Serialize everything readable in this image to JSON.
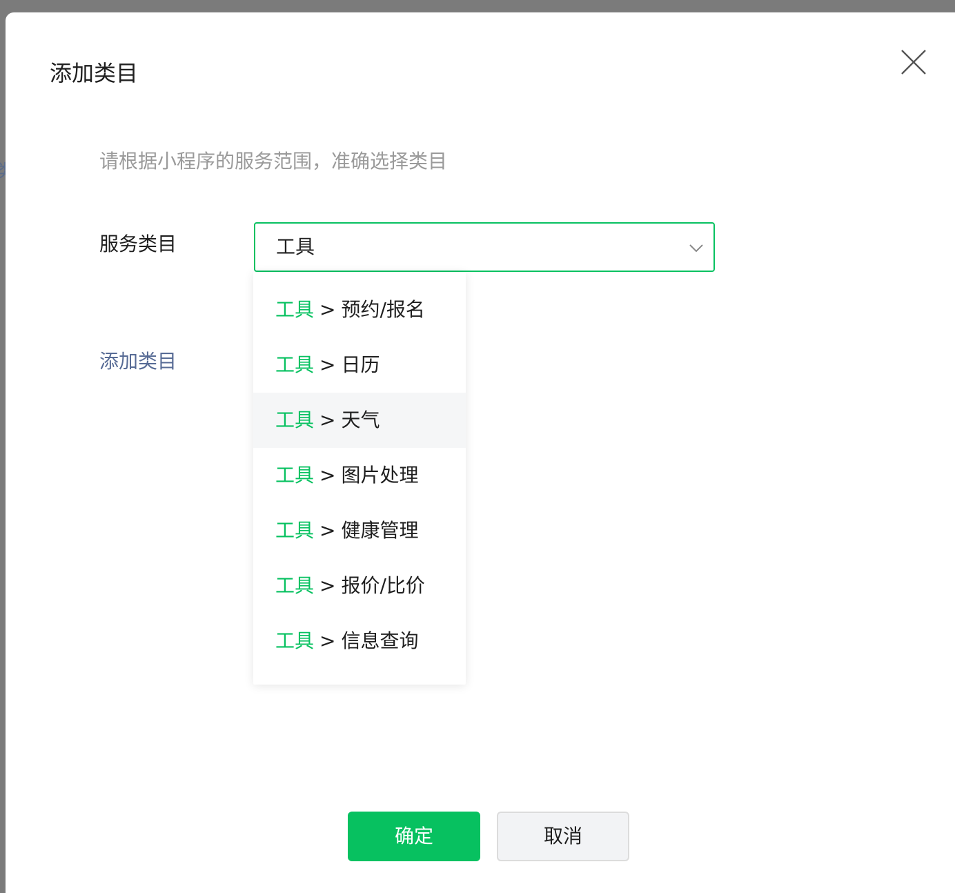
{
  "background": {
    "glyph": "类"
  },
  "dialog": {
    "title": "添加类目",
    "close_icon": "close-icon",
    "hint": "请根据小程序的服务范围，准确选择类目",
    "field_label": "服务类目",
    "select": {
      "value": "工具",
      "arrow_icon": "chevron-down-icon"
    },
    "add_link": "添加类目",
    "dropdown": {
      "prefix": "工具",
      "separator": ">",
      "items": [
        {
          "label": "预约/报名"
        },
        {
          "label": "日历"
        },
        {
          "label": "天气",
          "hovered": true
        },
        {
          "label": "图片处理"
        },
        {
          "label": "健康管理"
        },
        {
          "label": "报价/比价"
        },
        {
          "label": "信息查询"
        }
      ]
    },
    "buttons": {
      "confirm": "确定",
      "cancel": "取消"
    }
  },
  "colors": {
    "accent": "#07c160",
    "link": "#576b95",
    "hint_text": "#9a9a9a",
    "overlay": "#7b7b7b"
  }
}
